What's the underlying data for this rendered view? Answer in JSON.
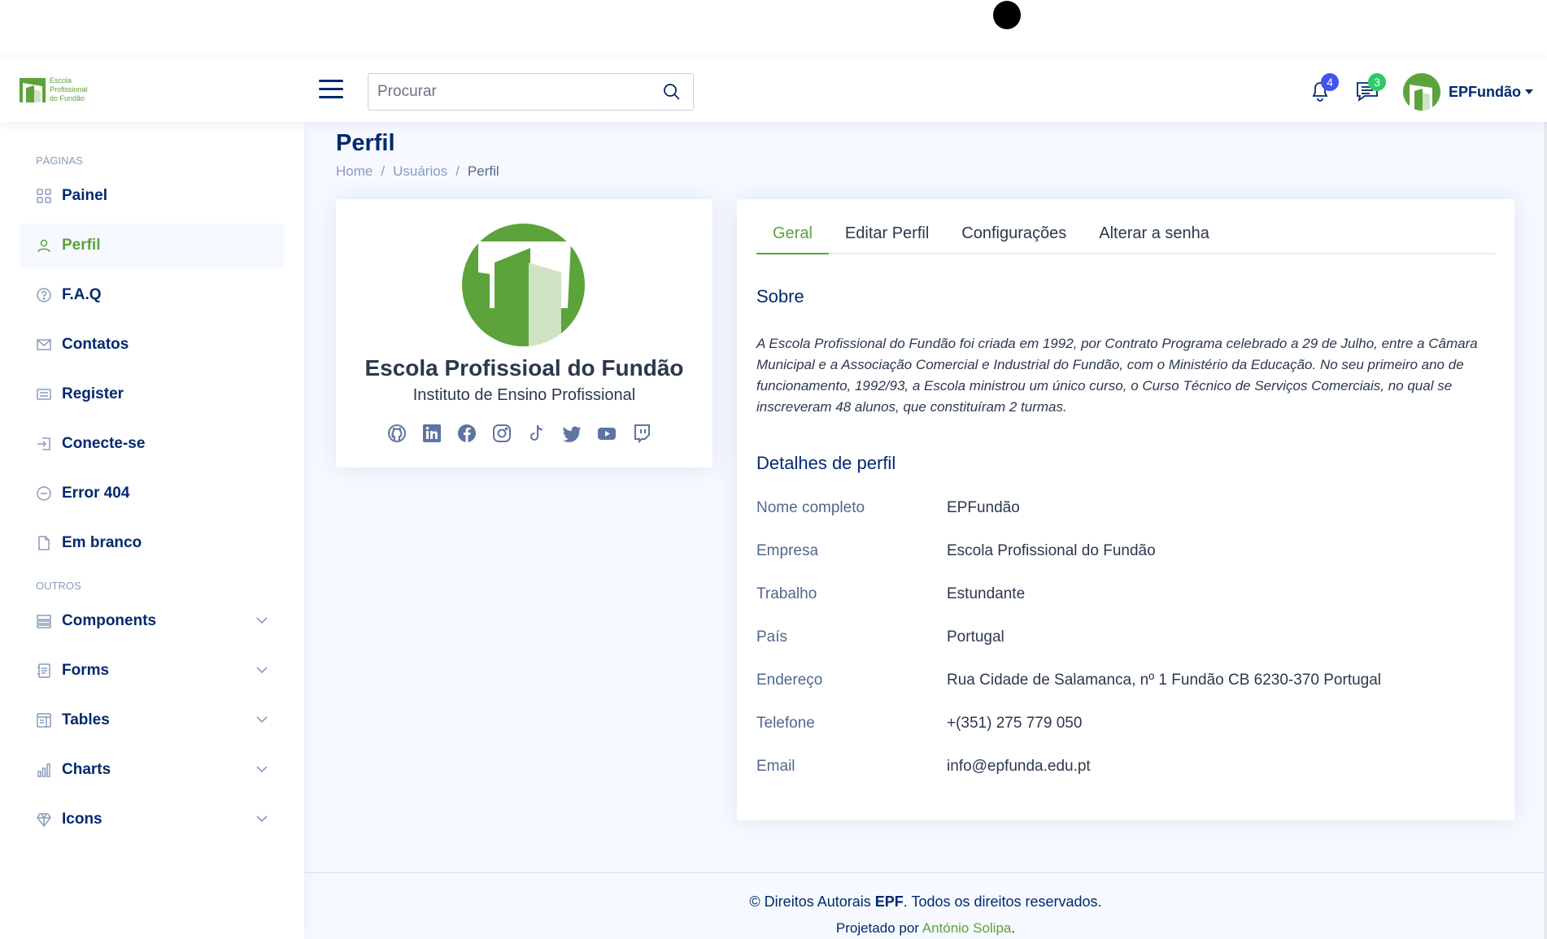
{
  "header": {
    "logo_lines": [
      "Escola",
      "Profissional",
      "do Fundão"
    ],
    "search_placeholder": "Procurar",
    "notifications_count": "4",
    "messages_count": "3",
    "profile_name": "EPFundão",
    "colors": {
      "brand": "#5ba33a",
      "notif_badge": "#4154f1",
      "msg_badge": "#2eca6a",
      "navy": "#012970"
    }
  },
  "sidebar": {
    "heading_pages": "PÁGINAS",
    "pages": [
      {
        "label": "Painel",
        "icon": "grid-icon"
      },
      {
        "label": "Perfil",
        "icon": "person-icon",
        "active": true
      },
      {
        "label": "F.A.Q",
        "icon": "question-circle-icon"
      },
      {
        "label": "Contatos",
        "icon": "envelope-icon"
      },
      {
        "label": "Register",
        "icon": "card-list-icon"
      },
      {
        "label": "Conecte-se",
        "icon": "box-arrow-in-right-icon"
      },
      {
        "label": "Error 404",
        "icon": "dash-circle-icon"
      },
      {
        "label": "Em branco",
        "icon": "file-icon"
      }
    ],
    "heading_others": "OUTROS",
    "others": [
      {
        "label": "Components",
        "icon": "menu-button-icon"
      },
      {
        "label": "Forms",
        "icon": "journal-text-icon"
      },
      {
        "label": "Tables",
        "icon": "layout-text-window-icon"
      },
      {
        "label": "Charts",
        "icon": "bar-chart-icon"
      },
      {
        "label": "Icons",
        "icon": "gem-icon"
      }
    ]
  },
  "main": {
    "page_title": "Perfil",
    "breadcrumb": [
      "Home",
      "Usuários",
      "Perfil"
    ],
    "profile_card": {
      "name": "Escola Profissioal do Fundão",
      "subtitle": "Instituto de Ensino Profissional",
      "socials": [
        "github-icon",
        "linkedin-icon",
        "facebook-icon",
        "instagram-icon",
        "tiktok-icon",
        "twitter-icon",
        "youtube-icon",
        "twitch-icon"
      ]
    },
    "tabs": [
      "Geral",
      "Editar Perfil",
      "Configurações",
      "Alterar a senha"
    ],
    "about_title": "Sobre",
    "about_text": "A Escola Profissional do Fundão foi criada em 1992, por Contrato Programa celebrado a 29 de Julho, entre a Câmara Municipal e a Associação Comercial e Industrial do Fundão, com o Ministério da Educação. No seu primeiro ano de funcionamento, 1992/93, a Escola ministrou um único curso, o Curso Técnico de Serviços Comerciais, no qual se inscreveram 48 alunos, que constituíram 2 turmas.",
    "details_title": "Detalhes de perfil",
    "details": [
      {
        "label": "Nome completo",
        "value": "EPFundão"
      },
      {
        "label": "Empresa",
        "value": "Escola Profissional do Fundão"
      },
      {
        "label": "Trabalho",
        "value": "Estundante"
      },
      {
        "label": "País",
        "value": "Portugal"
      },
      {
        "label": "Endereço",
        "value": "Rua Cidade de Salamanca, nº 1 Fundão CB 6230-370 Portugal"
      },
      {
        "label": "Telefone",
        "value": "+(351) 275 779 050"
      },
      {
        "label": "Email",
        "value": "info@epfunda.edu.pt"
      }
    ]
  },
  "footer": {
    "copyright_prefix": "© Direitos Autorais ",
    "copyright_brand": "EPF",
    "copyright_suffix": ". Todos os direitos reservados.",
    "designed_prefix": "Projetado por ",
    "designer": "António Solipa",
    "designed_suffix": "."
  }
}
